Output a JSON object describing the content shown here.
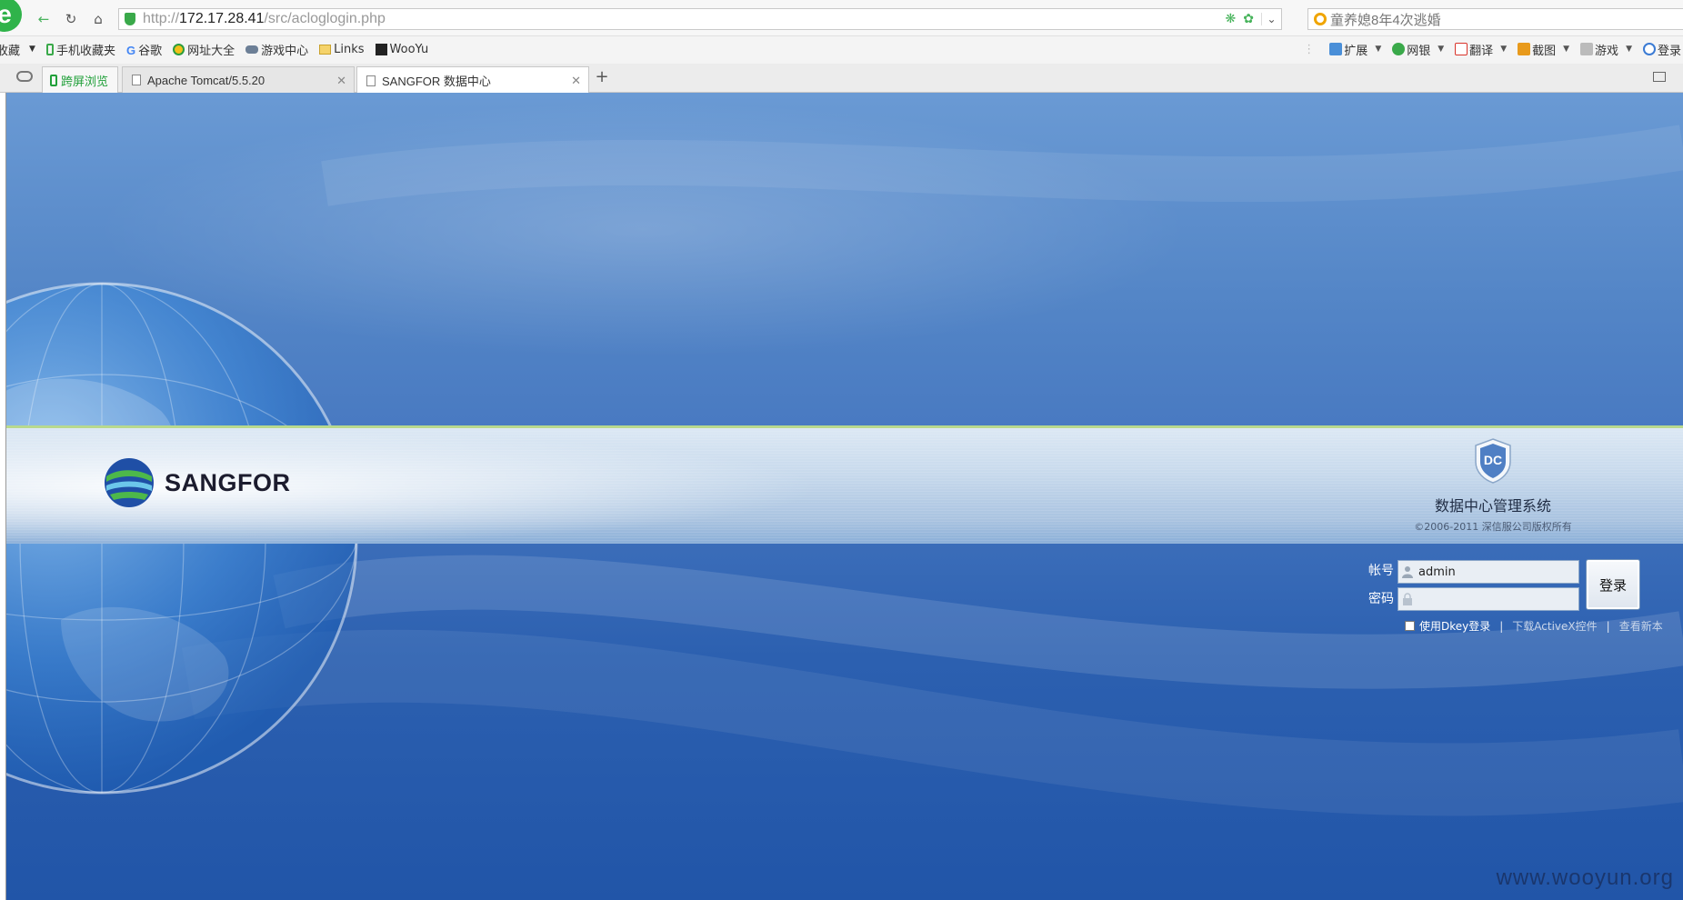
{
  "browser": {
    "url_prefix": "http://",
    "url_host": "172.17.28.41",
    "url_path": "/src/acloglogin.php",
    "search_placeholder": "童养媳8年4次逃婚",
    "bookmarks": [
      {
        "label": "收藏",
        "icon": "star-icon"
      },
      {
        "label": "手机收藏夹",
        "icon": "phone-icon"
      },
      {
        "label": "谷歌",
        "icon": "google-icon"
      },
      {
        "label": "网址大全",
        "icon": "web-directory-icon"
      },
      {
        "label": "游戏中心",
        "icon": "gamepad-icon"
      },
      {
        "label": "Links",
        "icon": "folder-icon"
      },
      {
        "label": "WooYu",
        "icon": "wooyun-icon"
      }
    ],
    "tools": [
      {
        "label": "扩展",
        "icon": "extensions-icon",
        "color": "#4a8fd8"
      },
      {
        "label": "网银",
        "icon": "bank-shield-icon",
        "color": "#3aa94a"
      },
      {
        "label": "翻译",
        "icon": "translate-icon",
        "color": "#d9342b"
      },
      {
        "label": "截图",
        "icon": "screenshot-icon",
        "color": "#e89a1c"
      },
      {
        "label": "游戏",
        "icon": "game-icon",
        "color": "#888888"
      },
      {
        "label": "登录",
        "icon": "login-icon",
        "color": "#3b7bd4"
      }
    ],
    "tabs": {
      "split_view": "跨屏浏览",
      "tab1": "Apache Tomcat/5.5.20",
      "tab2": "SANGFOR 数据中心",
      "new_tab": "+"
    }
  },
  "page": {
    "brand": "SANGFOR",
    "badge_text": "DC",
    "system_title": "数据中心管理系统",
    "copyright": "©2006-2011   深信服公司版权所有",
    "login": {
      "account_label": "帐号",
      "account_value": "admin",
      "password_label": "密码",
      "password_value": "",
      "submit_label": "登录",
      "dkey_label": "使用Dkey登录",
      "separator": "|",
      "activex_link": "下载ActiveX控件",
      "new_version_link": "查看新本"
    },
    "watermark": "www.wooyun.org",
    "colors": {
      "band_accent": "#b8d98e",
      "background_top": "#6a9ad4",
      "background_bottom": "#2155a8",
      "browser_green": "#2fb34a"
    }
  }
}
